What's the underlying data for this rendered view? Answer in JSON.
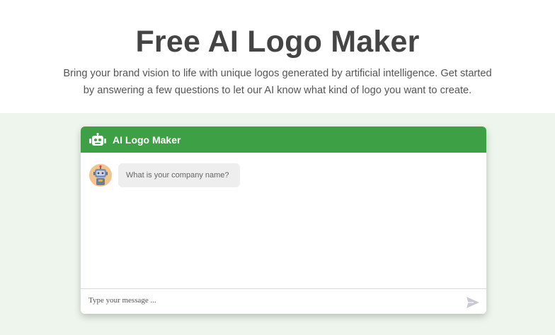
{
  "hero": {
    "title": "Free AI Logo Maker",
    "subtitle": "Bring your brand vision to life with unique logos generated by artificial intelligence. Get started by answering a few questions to let our AI know what kind of logo you want to create."
  },
  "chat": {
    "header_icon": "robot-icon",
    "title": "AI Logo Maker",
    "messages": [
      {
        "sender": "bot",
        "avatar_icon": "robot-avatar",
        "text": "What is your company name?"
      }
    ],
    "input": {
      "placeholder": "Type your message ...",
      "value": ""
    },
    "send_icon": "send-icon"
  },
  "colors": {
    "header_green": "#3da045",
    "band_green": "#edf5ec",
    "title_gray": "#444444",
    "bubble_gray": "#eeeeee",
    "send_icon": "#c9c9d3"
  }
}
